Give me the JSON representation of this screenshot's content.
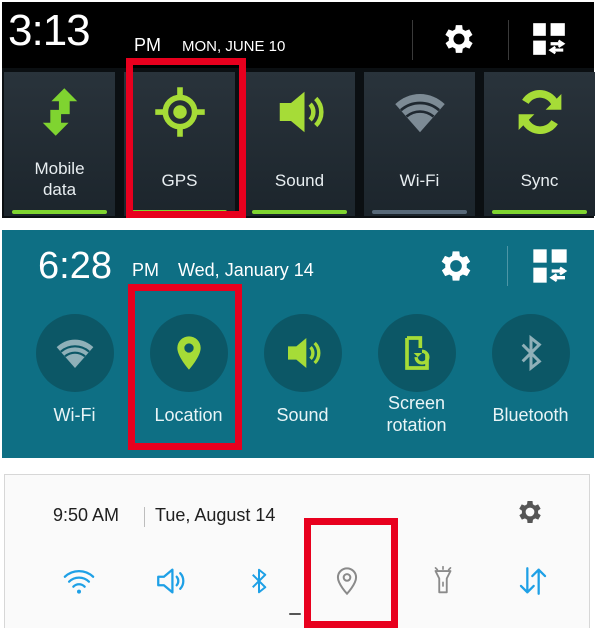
{
  "colors": {
    "highlight": "#e8001e",
    "panel1_accent": "#7fd430",
    "panel2_bg": "#0e6f84",
    "panel2_icon": "#a6dc37",
    "panel3_icon_active": "#1ea0e6",
    "panel3_icon_inactive": "#8a8a8a"
  },
  "panel1": {
    "time": "3:13",
    "ampm": "PM",
    "date": "MON, JUNE 10",
    "icons": {
      "settings": "gear-icon",
      "edit": "grid-edit-icon"
    },
    "tiles": [
      {
        "label": "Mobile\ndata",
        "icon": "mobile-data-arrows-icon",
        "active": true
      },
      {
        "label": "GPS",
        "icon": "gps-target-icon",
        "active": true,
        "highlighted": true
      },
      {
        "label": "Sound",
        "icon": "speaker-icon",
        "active": true
      },
      {
        "label": "Wi-Fi",
        "icon": "wifi-icon",
        "active": false
      },
      {
        "label": "Sync",
        "icon": "sync-icon",
        "active": true
      }
    ]
  },
  "panel2": {
    "time": "6:28",
    "ampm": "PM",
    "date": "Wed, January 14",
    "icons": {
      "settings": "gear-icon",
      "edit": "grid-edit-icon"
    },
    "tiles": [
      {
        "label": "Wi-Fi",
        "icon": "wifi-icon",
        "active": false
      },
      {
        "label": "Location",
        "icon": "location-pin-icon",
        "active": true,
        "highlighted": true
      },
      {
        "label": "Sound",
        "icon": "speaker-icon",
        "active": true
      },
      {
        "label": "Screen\nrotation",
        "icon": "screen-rotation-icon",
        "active": true
      },
      {
        "label": "Bluetooth",
        "icon": "bluetooth-icon",
        "active": false
      }
    ]
  },
  "panel3": {
    "time": "9:50 AM",
    "date": "Tue, August 14",
    "icons": {
      "settings": "gear-icon"
    },
    "tiles": [
      {
        "icon": "wifi-icon",
        "active": true
      },
      {
        "icon": "speaker-icon",
        "active": true
      },
      {
        "icon": "bluetooth-icon",
        "active": true
      },
      {
        "icon": "location-pin-icon",
        "active": false,
        "highlighted": true
      },
      {
        "icon": "flashlight-icon",
        "active": false
      },
      {
        "icon": "data-arrows-icon",
        "active": true
      }
    ]
  }
}
